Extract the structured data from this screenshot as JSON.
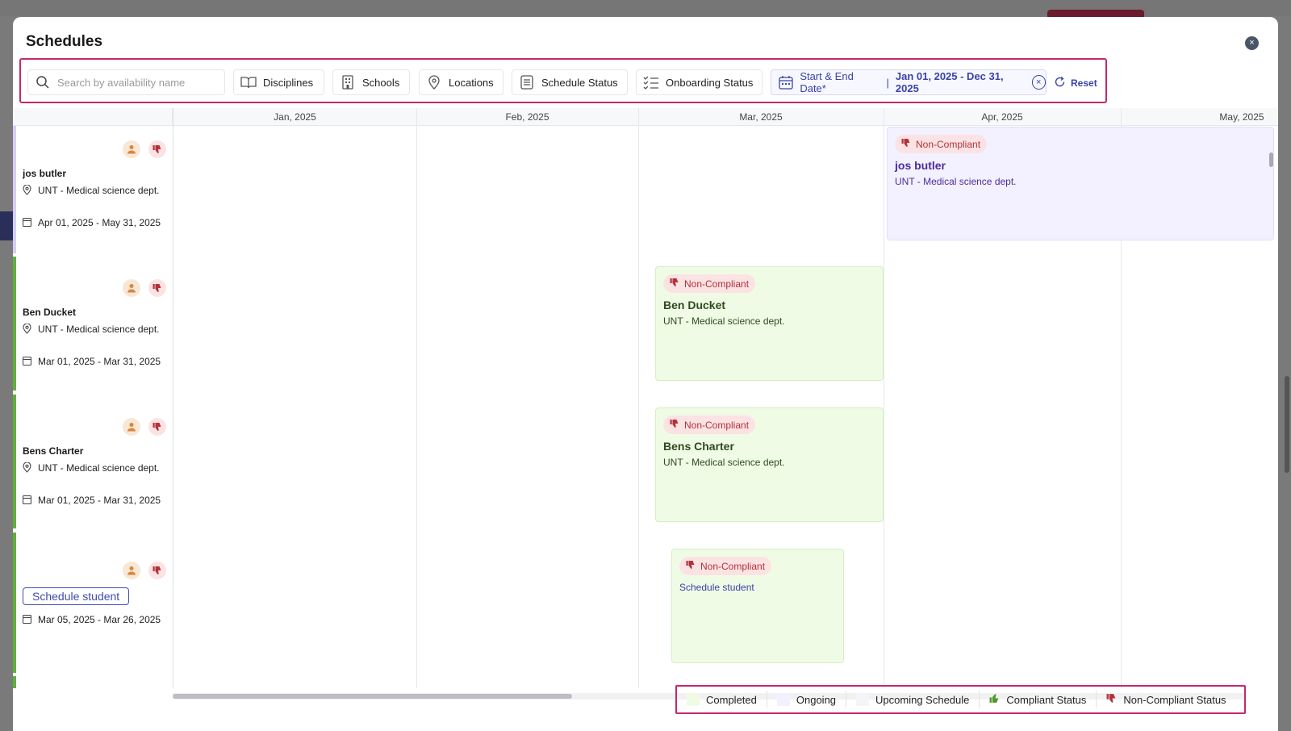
{
  "modal": {
    "title": "Schedules",
    "close_label": "×"
  },
  "filters": {
    "search_placeholder": "Search by availability name",
    "disciplines": "Disciplines",
    "schools": "Schools",
    "locations": "Locations",
    "schedule_status": "Schedule Status",
    "onboarding_status": "Onboarding Status",
    "date_label": "Start & End Date*",
    "date_separator": "|",
    "date_value": "Jan 01, 2025 - Dec 31, 2025",
    "clear_label": "×",
    "reset": "Reset"
  },
  "months": [
    "Jan, 2025",
    "Feb, 2025",
    "Mar, 2025",
    "Apr, 2025",
    "May, 2025"
  ],
  "rows": [
    {
      "name": "jos butler",
      "location": "UNT - Medical science dept.",
      "dates": "Apr 01, 2025 - May 31, 2025",
      "status": "ongoing",
      "bar_color": "#d9cdf5"
    },
    {
      "name": "Ben Ducket",
      "location": "UNT - Medical science dept.",
      "dates": "Mar 01, 2025 - Mar 31, 2025",
      "status": "completed",
      "bar_color": "#5fb13a"
    },
    {
      "name": "Bens  Charter",
      "location": "UNT - Medical science dept.",
      "dates": "Mar 01, 2025 - Mar 31, 2025",
      "status": "completed",
      "bar_color": "#5fb13a"
    },
    {
      "name": "Schedule student",
      "location": "",
      "dates": "Mar 05, 2025 - Mar 26, 2025",
      "status": "completed",
      "bar_color": "#5fb13a"
    }
  ],
  "cards": [
    {
      "badge": "Non-Compliant",
      "name": "jos butler",
      "dept": "UNT - Medical science dept."
    },
    {
      "badge": "Non-Compliant",
      "name": "Ben Ducket",
      "dept": "UNT - Medical science dept."
    },
    {
      "badge": "Non-Compliant",
      "name": "Bens  Charter",
      "dept": "UNT - Medical science dept."
    },
    {
      "badge": "Non-Compliant",
      "link": "Schedule student"
    }
  ],
  "legend": {
    "completed": "Completed",
    "ongoing": "Ongoing",
    "upcoming": "Upcoming Schedule",
    "compliant": "Compliant Status",
    "noncompliant": "Non-Compliant Status"
  },
  "colors": {
    "accent": "#3942a8",
    "highlight_border": "#c7286b",
    "completed": "#f0fbe6",
    "ongoing": "#f3f0ff",
    "upcoming": "#f4f5f8",
    "noncompliant": "#b23239",
    "compliant": "#4b9a2a"
  },
  "icons": [
    "search-icon",
    "book-icon",
    "building-icon",
    "map-pin-icon",
    "list-icon",
    "checklist-icon",
    "calendar-icon",
    "clear-icon",
    "refresh-icon",
    "close-icon",
    "person-icon",
    "thumbs-down-icon",
    "thumbs-up-icon"
  ]
}
